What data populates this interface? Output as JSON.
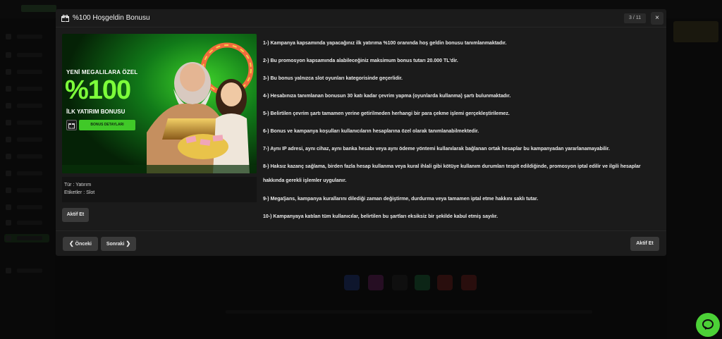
{
  "modal": {
    "title": "%100 Hoşgeldin Bonusu",
    "pager": {
      "current": "3",
      "sep": "/",
      "total": "11"
    },
    "close_label": "×"
  },
  "banner": {
    "line1": "YENİ MEGALILARA ÖZEL",
    "big": "%100",
    "line2": "İLK YATIRIM BONUSU",
    "button": "BONUS DETAYLARI"
  },
  "info": {
    "type": "Tür : Yatırım",
    "tags": "Etiketler : Slot"
  },
  "rules": [
    "1-) Kampanya kapsamında yapacağınız ilk yatırıma %100 oranında hoş geldin bonusu tanımlanmaktadır.",
    "2-) Bu promosyon kapsamında alabileceğiniz maksimum bonus tutarı 20.000 TL'dir.",
    "3-) Bu bonus yalnızca slot oyunları kategorisinde geçerlidir.",
    "4-) Hesabınıza tanımlanan bonusun 30 katı kadar çevrim yapma (oyunlarda kullanma) şartı bulunmaktadır.",
    "5-) Belirtilen çevrim şartı tamamen yerine getirilmeden herhangi bir para çekme işlemi gerçekleştirilemez.",
    "6-) Bonus ve kampanya koşulları kullanıcıların hesaplarına özel olarak tanımlanabilmektedir.",
    "7-) Aynı IP adresi, aynı cihaz, aynı banka hesabı veya aynı ödeme yöntemi kullanılarak bağlanan ortak hesaplar bu kampanyadan yararlanamayabilir.",
    "8-) Haksız kazanç sağlama, birden fazla hesap kullanma veya kural ihlali gibi kötüye kullanım durumları tespit edildiğinde, promosyon iptal edilir ve ilgili hesaplar hakkında gerekli işlemler uygulanır.",
    "9-) MegaŞans, kampanya kurallarını dilediği zaman değiştirme, durdurma veya tamamen iptal etme hakkını saklı tutar.",
    "10-) Kampanyaya katılan tüm kullanıcılar, belirtilen bu şartları eksiksiz bir şekilde kabul etmiş sayılır."
  ],
  "buttons": {
    "activate": "Aktif Et",
    "prev": "Önceki",
    "next": "Sonraki"
  },
  "icons": {
    "gift": "gift-icon",
    "close": "close-icon",
    "prev": "chevron-left-icon",
    "next": "chevron-right-icon",
    "chat": "chat-bubble-icon"
  },
  "colors": {
    "accent_green": "#40c928",
    "banner_text_green": "#7dff3a",
    "modal_bg": "#1b1b1b",
    "button_bg": "#3a3a3a"
  }
}
